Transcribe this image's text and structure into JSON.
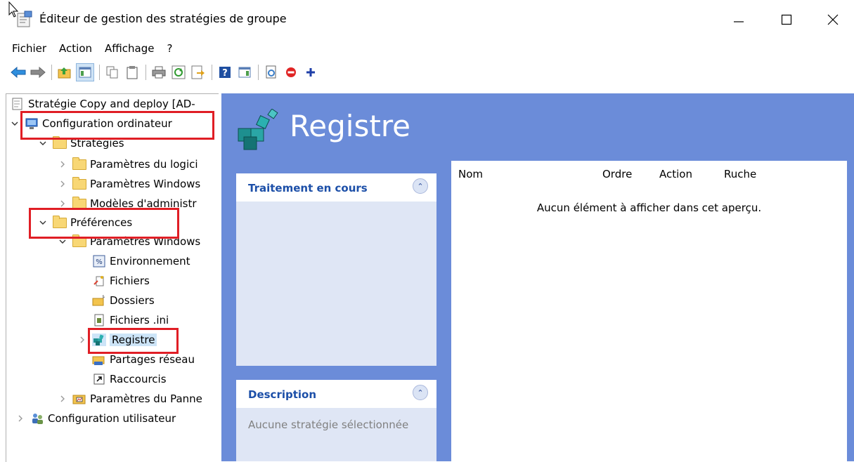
{
  "window": {
    "title": "Éditeur de gestion des stratégies de groupe",
    "icon": "gpo-editor-icon"
  },
  "menu": [
    "Fichier",
    "Action",
    "Affichage",
    "?"
  ],
  "toolbar": {
    "icons": [
      "back-arrow-icon",
      "forward-arrow-icon",
      "up-folder-icon",
      "show-hide-tree-icon",
      "copy-icon",
      "paste-icon",
      "print-icon",
      "refresh-icon",
      "export-icon",
      "help-icon",
      "properties-pane-icon",
      "new-item-icon",
      "stop-icon",
      "add-icon"
    ]
  },
  "tree": {
    "root": "Stratégie Copy and deploy [AD-",
    "computer_config": "Configuration ordinateur",
    "strategies": "Stratégies",
    "software_settings": "Paramètres du logici",
    "windows_settings": "Paramètres Windows",
    "admin_templates": "Modèles d'administr",
    "preferences": "Préférences",
    "pref_windows_settings": "Paramètres Windows",
    "environment": "Environnement",
    "files": "Fichiers",
    "folders": "Dossiers",
    "ini_files": "Fichiers .ini",
    "registry": "Registre",
    "network_shares": "Partages réseau",
    "shortcuts": "Raccourcis",
    "control_panel": "Paramètres du Panne",
    "user_config": "Configuration utilisateur"
  },
  "pane": {
    "title": "Registre",
    "processing_header": "Traitement en cours",
    "description_header": "Description",
    "description_text": "Aucune stratégie sélectionnée",
    "columns": [
      "Nom",
      "Ordre",
      "Action",
      "Ruche"
    ],
    "empty_message": "Aucun élément à afficher dans cet aperçu."
  },
  "colors": {
    "pane_background": "#6b8cd9",
    "highlight": "#e01e25",
    "section_header_text": "#1c4fa8"
  }
}
